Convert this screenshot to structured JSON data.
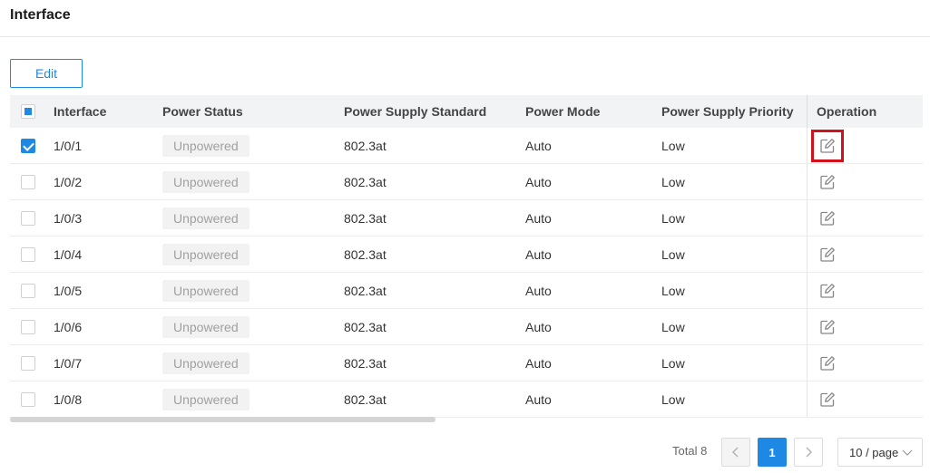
{
  "header": {
    "title": "Interface"
  },
  "toolbar": {
    "edit_label": "Edit"
  },
  "table": {
    "columns": [
      "Interface",
      "Power Status",
      "Power Supply Standard",
      "Power Mode",
      "Power Supply Priority",
      "Operation"
    ],
    "rows": [
      {
        "interface": "1/0/1",
        "power_status": "Unpowered",
        "standard": "802.3at",
        "mode": "Auto",
        "priority": "Low",
        "checked": true
      },
      {
        "interface": "1/0/2",
        "power_status": "Unpowered",
        "standard": "802.3at",
        "mode": "Auto",
        "priority": "Low",
        "checked": false
      },
      {
        "interface": "1/0/3",
        "power_status": "Unpowered",
        "standard": "802.3at",
        "mode": "Auto",
        "priority": "Low",
        "checked": false
      },
      {
        "interface": "1/0/4",
        "power_status": "Unpowered",
        "standard": "802.3at",
        "mode": "Auto",
        "priority": "Low",
        "checked": false
      },
      {
        "interface": "1/0/5",
        "power_status": "Unpowered",
        "standard": "802.3at",
        "mode": "Auto",
        "priority": "Low",
        "checked": false
      },
      {
        "interface": "1/0/6",
        "power_status": "Unpowered",
        "standard": "802.3at",
        "mode": "Auto",
        "priority": "Low",
        "checked": false
      },
      {
        "interface": "1/0/7",
        "power_status": "Unpowered",
        "standard": "802.3at",
        "mode": "Auto",
        "priority": "Low",
        "checked": false
      },
      {
        "interface": "1/0/8",
        "power_status": "Unpowered",
        "standard": "802.3at",
        "mode": "Auto",
        "priority": "Low",
        "checked": false
      }
    ]
  },
  "pagination": {
    "total_label": "Total 8",
    "current_page": "1",
    "page_size_label": "10 / page"
  },
  "icons": {
    "edit": "edit-icon",
    "prev": "chevron-left-icon",
    "next": "chevron-right-icon",
    "dropdown": "chevron-down-icon"
  },
  "colors": {
    "accent": "#1e88e5",
    "highlight": "#d0121b",
    "badge_bg": "#f2f2f2",
    "badge_text": "#a0a0a0"
  }
}
